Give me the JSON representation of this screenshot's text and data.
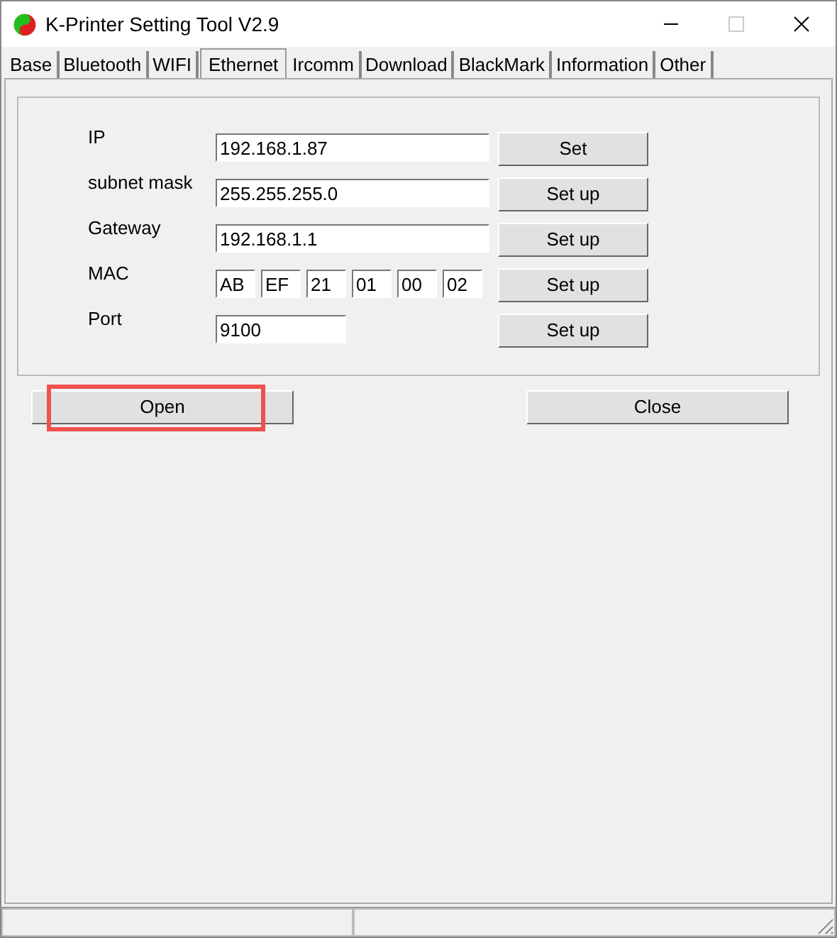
{
  "window": {
    "title": "K-Printer Setting Tool V2.9"
  },
  "tabs": [
    {
      "label": "Base",
      "selected": false
    },
    {
      "label": "Bluetooth",
      "selected": false
    },
    {
      "label": "WIFI",
      "selected": false
    },
    {
      "label": "Ethernet",
      "selected": true
    },
    {
      "label": "Ircomm",
      "selected": false
    },
    {
      "label": "Download",
      "selected": false
    },
    {
      "label": "BlackMark",
      "selected": false
    },
    {
      "label": "Information",
      "selected": false
    },
    {
      "label": "Other",
      "selected": false
    }
  ],
  "settings": [
    {
      "label": "IP",
      "kind": "text",
      "value": "192.168.1.87",
      "button": "Set"
    },
    {
      "label": "subnet mask",
      "kind": "text",
      "value": "255.255.255.0",
      "button": "Set up"
    },
    {
      "label": "Gateway",
      "kind": "text",
      "value": "192.168.1.1",
      "button": "Set up"
    },
    {
      "label": "MAC",
      "kind": "octets",
      "values": [
        "AB",
        "EF",
        "21",
        "01",
        "00",
        "02"
      ],
      "button": "Set up"
    },
    {
      "label": "Port",
      "kind": "short",
      "value": "9100",
      "button": "Set up"
    }
  ],
  "actions": [
    {
      "label": "Open",
      "highlighted": true
    },
    {
      "label": "Close",
      "highlighted": false
    }
  ]
}
